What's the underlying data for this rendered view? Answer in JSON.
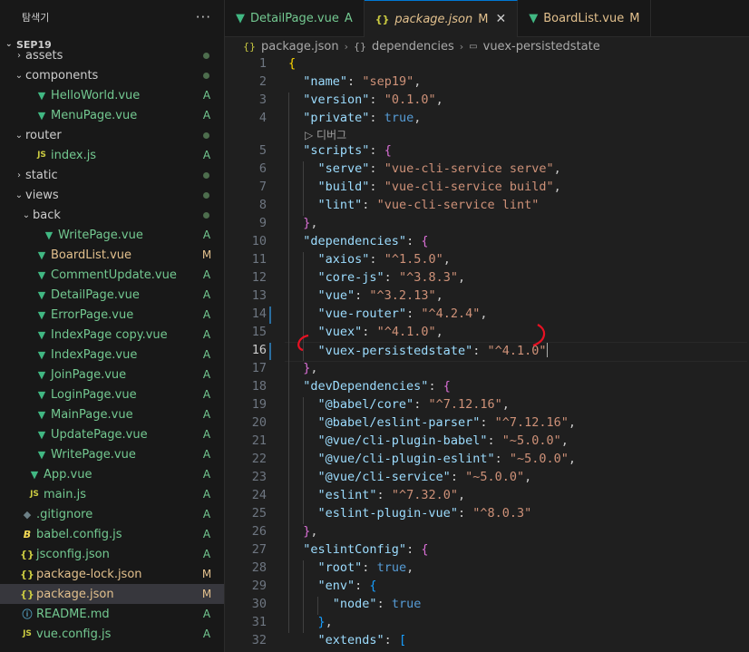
{
  "explorer": {
    "title": "탐색기",
    "more_icon": "ellipsis-icon",
    "section": "SEP19",
    "items": [
      {
        "label": "assets",
        "kind": "folder",
        "open": false,
        "depth": 1,
        "status": "dot"
      },
      {
        "label": "components",
        "kind": "folder",
        "open": true,
        "depth": 1,
        "status": "dot"
      },
      {
        "label": "HelloWorld.vue",
        "kind": "vue",
        "depth": 2,
        "status": "A"
      },
      {
        "label": "MenuPage.vue",
        "kind": "vue",
        "depth": 2,
        "status": "A"
      },
      {
        "label": "router",
        "kind": "folder",
        "open": true,
        "depth": 1,
        "status": "dot"
      },
      {
        "label": "index.js",
        "kind": "js",
        "depth": 2,
        "status": "A"
      },
      {
        "label": "static",
        "kind": "folder",
        "open": false,
        "depth": 1,
        "status": "dot"
      },
      {
        "label": "views",
        "kind": "folder",
        "open": true,
        "depth": 1,
        "status": "dot"
      },
      {
        "label": "back",
        "kind": "folder",
        "open": true,
        "depth": 2,
        "status": "dot"
      },
      {
        "label": "WritePage.vue",
        "kind": "vue",
        "depth": 3,
        "status": "A"
      },
      {
        "label": "BoardList.vue",
        "kind": "vue",
        "depth": 2,
        "status": "M"
      },
      {
        "label": "CommentUpdate.vue",
        "kind": "vue",
        "depth": 2,
        "status": "A"
      },
      {
        "label": "DetailPage.vue",
        "kind": "vue",
        "depth": 2,
        "status": "A"
      },
      {
        "label": "ErrorPage.vue",
        "kind": "vue",
        "depth": 2,
        "status": "A"
      },
      {
        "label": "IndexPage copy.vue",
        "kind": "vue",
        "depth": 2,
        "status": "A"
      },
      {
        "label": "IndexPage.vue",
        "kind": "vue",
        "depth": 2,
        "status": "A"
      },
      {
        "label": "JoinPage.vue",
        "kind": "vue",
        "depth": 2,
        "status": "A"
      },
      {
        "label": "LoginPage.vue",
        "kind": "vue",
        "depth": 2,
        "status": "A"
      },
      {
        "label": "MainPage.vue",
        "kind": "vue",
        "depth": 2,
        "status": "A"
      },
      {
        "label": "UpdatePage.vue",
        "kind": "vue",
        "depth": 2,
        "status": "A"
      },
      {
        "label": "WritePage.vue",
        "kind": "vue",
        "depth": 2,
        "status": "A"
      },
      {
        "label": "App.vue",
        "kind": "vue",
        "depth": 1,
        "status": "A"
      },
      {
        "label": "main.js",
        "kind": "js",
        "depth": 1,
        "status": "A"
      },
      {
        "label": ".gitignore",
        "kind": "git",
        "depth": 0,
        "status": "A"
      },
      {
        "label": "babel.config.js",
        "kind": "babel",
        "depth": 0,
        "status": "A"
      },
      {
        "label": "jsconfig.json",
        "kind": "json",
        "depth": 0,
        "status": "A"
      },
      {
        "label": "package-lock.json",
        "kind": "json",
        "depth": 0,
        "status": "M"
      },
      {
        "label": "package.json",
        "kind": "json",
        "depth": 0,
        "status": "M",
        "selected": true
      },
      {
        "label": "README.md",
        "kind": "info",
        "depth": 0,
        "status": "A"
      },
      {
        "label": "vue.config.js",
        "kind": "js",
        "depth": 0,
        "status": "A"
      }
    ]
  },
  "tabs": [
    {
      "label": "DetailPage.vue",
      "status": "A",
      "kind": "vue",
      "active": false
    },
    {
      "label": "package.json",
      "status": "M",
      "kind": "json",
      "active": true
    },
    {
      "label": "BoardList.vue",
      "status": "M",
      "kind": "vue",
      "active": false
    }
  ],
  "breadcrumb": {
    "file": "package.json",
    "segments": [
      "dependencies",
      "vuex-persistedstate"
    ]
  },
  "codelens": "디버그",
  "editor": {
    "current_line": 16,
    "modified_lines": [
      14,
      16
    ],
    "lines": [
      {
        "n": 1,
        "t": [
          [
            "br1",
            "{"
          ]
        ]
      },
      {
        "n": 2,
        "t": [
          [
            "p",
            "  "
          ],
          [
            "k",
            "\"name\""
          ],
          [
            "p",
            ": "
          ],
          [
            "s",
            "\"sep19\""
          ],
          [
            "p",
            ","
          ]
        ]
      },
      {
        "n": 3,
        "t": [
          [
            "p",
            "  "
          ],
          [
            "k",
            "\"version\""
          ],
          [
            "p",
            ": "
          ],
          [
            "s",
            "\"0.1.0\""
          ],
          [
            "p",
            ","
          ]
        ]
      },
      {
        "n": 4,
        "t": [
          [
            "p",
            "  "
          ],
          [
            "k",
            "\"private\""
          ],
          [
            "p",
            ": "
          ],
          [
            "b",
            "true"
          ],
          [
            "p",
            ","
          ]
        ],
        "lens_after": true
      },
      {
        "n": 5,
        "t": [
          [
            "p",
            "  "
          ],
          [
            "k",
            "\"scripts\""
          ],
          [
            "p",
            ": "
          ],
          [
            "br2",
            "{"
          ]
        ]
      },
      {
        "n": 6,
        "t": [
          [
            "p",
            "    "
          ],
          [
            "k",
            "\"serve\""
          ],
          [
            "p",
            ": "
          ],
          [
            "s",
            "\"vue-cli-service serve\""
          ],
          [
            "p",
            ","
          ]
        ]
      },
      {
        "n": 7,
        "t": [
          [
            "p",
            "    "
          ],
          [
            "k",
            "\"build\""
          ],
          [
            "p",
            ": "
          ],
          [
            "s",
            "\"vue-cli-service build\""
          ],
          [
            "p",
            ","
          ]
        ]
      },
      {
        "n": 8,
        "t": [
          [
            "p",
            "    "
          ],
          [
            "k",
            "\"lint\""
          ],
          [
            "p",
            ": "
          ],
          [
            "s",
            "\"vue-cli-service lint\""
          ]
        ]
      },
      {
        "n": 9,
        "t": [
          [
            "p",
            "  "
          ],
          [
            "br2",
            "}"
          ],
          [
            "p",
            ","
          ]
        ]
      },
      {
        "n": 10,
        "t": [
          [
            "p",
            "  "
          ],
          [
            "k",
            "\"dependencies\""
          ],
          [
            "p",
            ": "
          ],
          [
            "br2",
            "{"
          ]
        ]
      },
      {
        "n": 11,
        "t": [
          [
            "p",
            "    "
          ],
          [
            "k",
            "\"axios\""
          ],
          [
            "p",
            ": "
          ],
          [
            "s",
            "\"^1.5.0\""
          ],
          [
            "p",
            ","
          ]
        ]
      },
      {
        "n": 12,
        "t": [
          [
            "p",
            "    "
          ],
          [
            "k",
            "\"core-js\""
          ],
          [
            "p",
            ": "
          ],
          [
            "s",
            "\"^3.8.3\""
          ],
          [
            "p",
            ","
          ]
        ]
      },
      {
        "n": 13,
        "t": [
          [
            "p",
            "    "
          ],
          [
            "k",
            "\"vue\""
          ],
          [
            "p",
            ": "
          ],
          [
            "s",
            "\"^3.2.13\""
          ],
          [
            "p",
            ","
          ]
        ]
      },
      {
        "n": 14,
        "t": [
          [
            "p",
            "    "
          ],
          [
            "k",
            "\"vue-router\""
          ],
          [
            "p",
            ": "
          ],
          [
            "s",
            "\"^4.2.4\""
          ],
          [
            "p",
            ","
          ]
        ]
      },
      {
        "n": 15,
        "t": [
          [
            "p",
            "    "
          ],
          [
            "k",
            "\"vuex\""
          ],
          [
            "p",
            ": "
          ],
          [
            "s",
            "\"^4.1.0\""
          ],
          [
            "p",
            ","
          ]
        ]
      },
      {
        "n": 16,
        "t": [
          [
            "p",
            "    "
          ],
          [
            "k",
            "\"vuex-persistedstate\""
          ],
          [
            "p",
            ": "
          ],
          [
            "s",
            "\"^4.1.0\""
          ]
        ],
        "cursor": true
      },
      {
        "n": 17,
        "t": [
          [
            "p",
            "  "
          ],
          [
            "br2",
            "}"
          ],
          [
            "p",
            ","
          ]
        ]
      },
      {
        "n": 18,
        "t": [
          [
            "p",
            "  "
          ],
          [
            "k",
            "\"devDependencies\""
          ],
          [
            "p",
            ": "
          ],
          [
            "br2",
            "{"
          ]
        ]
      },
      {
        "n": 19,
        "t": [
          [
            "p",
            "    "
          ],
          [
            "k",
            "\"@babel/core\""
          ],
          [
            "p",
            ": "
          ],
          [
            "s",
            "\"^7.12.16\""
          ],
          [
            "p",
            ","
          ]
        ]
      },
      {
        "n": 20,
        "t": [
          [
            "p",
            "    "
          ],
          [
            "k",
            "\"@babel/eslint-parser\""
          ],
          [
            "p",
            ": "
          ],
          [
            "s",
            "\"^7.12.16\""
          ],
          [
            "p",
            ","
          ]
        ]
      },
      {
        "n": 21,
        "t": [
          [
            "p",
            "    "
          ],
          [
            "k",
            "\"@vue/cli-plugin-babel\""
          ],
          [
            "p",
            ": "
          ],
          [
            "s",
            "\"~5.0.0\""
          ],
          [
            "p",
            ","
          ]
        ]
      },
      {
        "n": 22,
        "t": [
          [
            "p",
            "    "
          ],
          [
            "k",
            "\"@vue/cli-plugin-eslint\""
          ],
          [
            "p",
            ": "
          ],
          [
            "s",
            "\"~5.0.0\""
          ],
          [
            "p",
            ","
          ]
        ]
      },
      {
        "n": 23,
        "t": [
          [
            "p",
            "    "
          ],
          [
            "k",
            "\"@vue/cli-service\""
          ],
          [
            "p",
            ": "
          ],
          [
            "s",
            "\"~5.0.0\""
          ],
          [
            "p",
            ","
          ]
        ]
      },
      {
        "n": 24,
        "t": [
          [
            "p",
            "    "
          ],
          [
            "k",
            "\"eslint\""
          ],
          [
            "p",
            ": "
          ],
          [
            "s",
            "\"^7.32.0\""
          ],
          [
            "p",
            ","
          ]
        ]
      },
      {
        "n": 25,
        "t": [
          [
            "p",
            "    "
          ],
          [
            "k",
            "\"eslint-plugin-vue\""
          ],
          [
            "p",
            ": "
          ],
          [
            "s",
            "\"^8.0.3\""
          ]
        ]
      },
      {
        "n": 26,
        "t": [
          [
            "p",
            "  "
          ],
          [
            "br2",
            "}"
          ],
          [
            "p",
            ","
          ]
        ]
      },
      {
        "n": 27,
        "t": [
          [
            "p",
            "  "
          ],
          [
            "k",
            "\"eslintConfig\""
          ],
          [
            "p",
            ": "
          ],
          [
            "br2",
            "{"
          ]
        ]
      },
      {
        "n": 28,
        "t": [
          [
            "p",
            "    "
          ],
          [
            "k",
            "\"root\""
          ],
          [
            "p",
            ": "
          ],
          [
            "b",
            "true"
          ],
          [
            "p",
            ","
          ]
        ]
      },
      {
        "n": 29,
        "t": [
          [
            "p",
            "    "
          ],
          [
            "k",
            "\"env\""
          ],
          [
            "p",
            ": "
          ],
          [
            "br3",
            "{"
          ]
        ]
      },
      {
        "n": 30,
        "t": [
          [
            "p",
            "      "
          ],
          [
            "k",
            "\"node\""
          ],
          [
            "p",
            ": "
          ],
          [
            "b",
            "true"
          ]
        ]
      },
      {
        "n": 31,
        "t": [
          [
            "p",
            "    "
          ],
          [
            "br3",
            "}"
          ],
          [
            "p",
            ","
          ]
        ]
      },
      {
        "n": 32,
        "t": [
          [
            "p",
            "    "
          ],
          [
            "k",
            "\"extends\""
          ],
          [
            "p",
            ": "
          ],
          [
            "br3",
            "["
          ]
        ]
      }
    ]
  },
  "colors": {
    "accent": "#0078d4",
    "added": "#73c991",
    "modified": "#e2c08d",
    "annotation": "#e81123"
  }
}
